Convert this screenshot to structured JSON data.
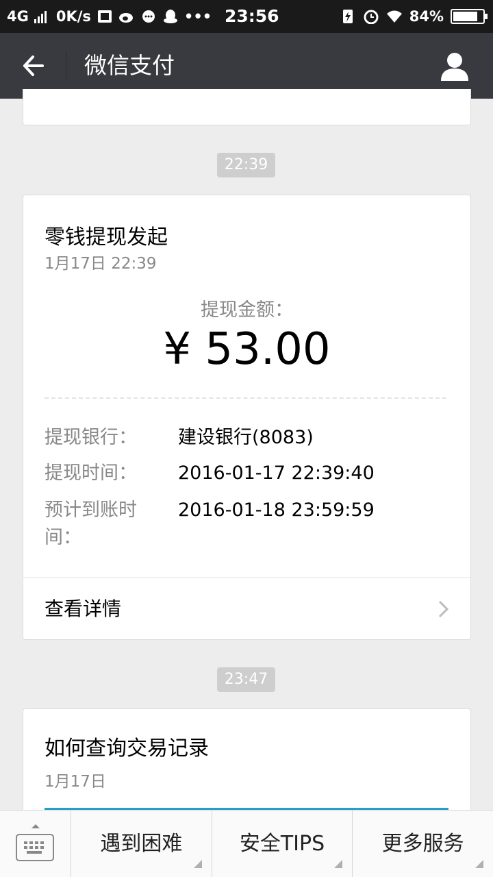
{
  "status_bar": {
    "network": "4G",
    "speed": "0K/s",
    "time": "23:56",
    "battery": "84%",
    "battery_level": 0.84
  },
  "header": {
    "title": "微信支付"
  },
  "timestamps": [
    "22:39",
    "23:47"
  ],
  "withdraw_card": {
    "title": "零钱提现发起",
    "date": "1月17日  22:39",
    "amount_label": "提现金额：",
    "amount": "¥ 53.00",
    "rows": [
      {
        "label": "提现银行：",
        "value": "建设银行(8083)"
      },
      {
        "label": "提现时间：",
        "value": "2016-01-17 22:39:40"
      },
      {
        "label": "预计到账时间：",
        "value": "2016-01-18 23:59:59"
      }
    ],
    "detail": "查看详情"
  },
  "query_card": {
    "title": "如何查询交易记录",
    "date": "1月17日"
  },
  "bottom_menu": [
    "遇到困难",
    "安全TIPS",
    "更多服务"
  ],
  "colors": {
    "status_bar_bg": "#1a1a1a",
    "header_bg": "#393a3f",
    "page_bg": "#ededed",
    "accent_line": "#2a9cc8"
  }
}
